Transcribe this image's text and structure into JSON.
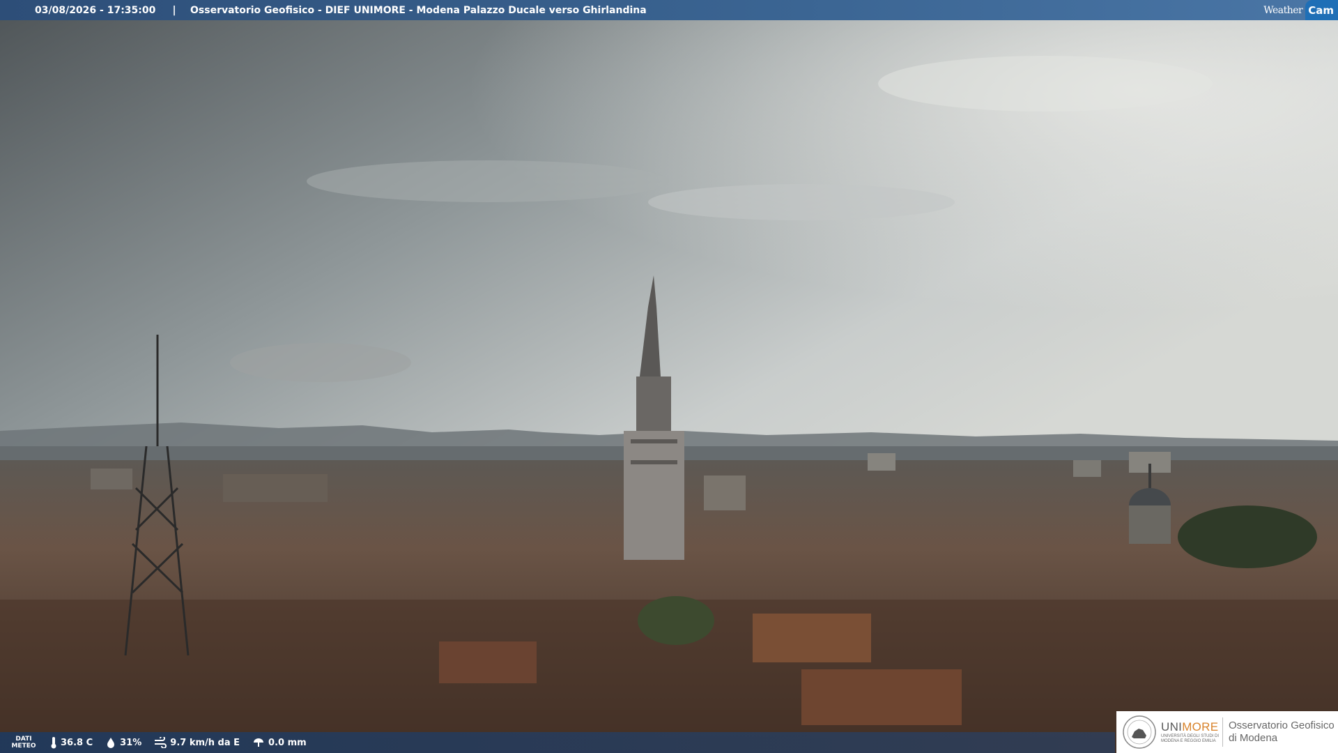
{
  "header": {
    "datetime": "03/08/2026 - 17:35:00",
    "separator": "|",
    "camera_title": "Osservatorio Geofisico - DIEF UNIMORE - Modena Palazzo Ducale verso Ghirlandina",
    "brand_weather": "Weather",
    "brand_cam": "Cam"
  },
  "weather_data": {
    "label_line1": "DATI",
    "label_line2": "METEO",
    "temperature": "36.8 C",
    "humidity": "31%",
    "wind": "9.7 km/h da E",
    "rain": "0.0 mm"
  },
  "logo": {
    "university": "UNI",
    "university_accent": "MORE",
    "university_sub1": "UNIVERSITÀ DEGLI STUDI DI",
    "university_sub2": "MODENA E REGGIO EMILIA",
    "observatory_line1": "Osservatorio Geofisico",
    "observatory_line2": "di Modena"
  },
  "colors": {
    "header_bar": "#3b6593",
    "brand_accent": "#1f6fb6",
    "unimore_orange": "#d8822a"
  }
}
